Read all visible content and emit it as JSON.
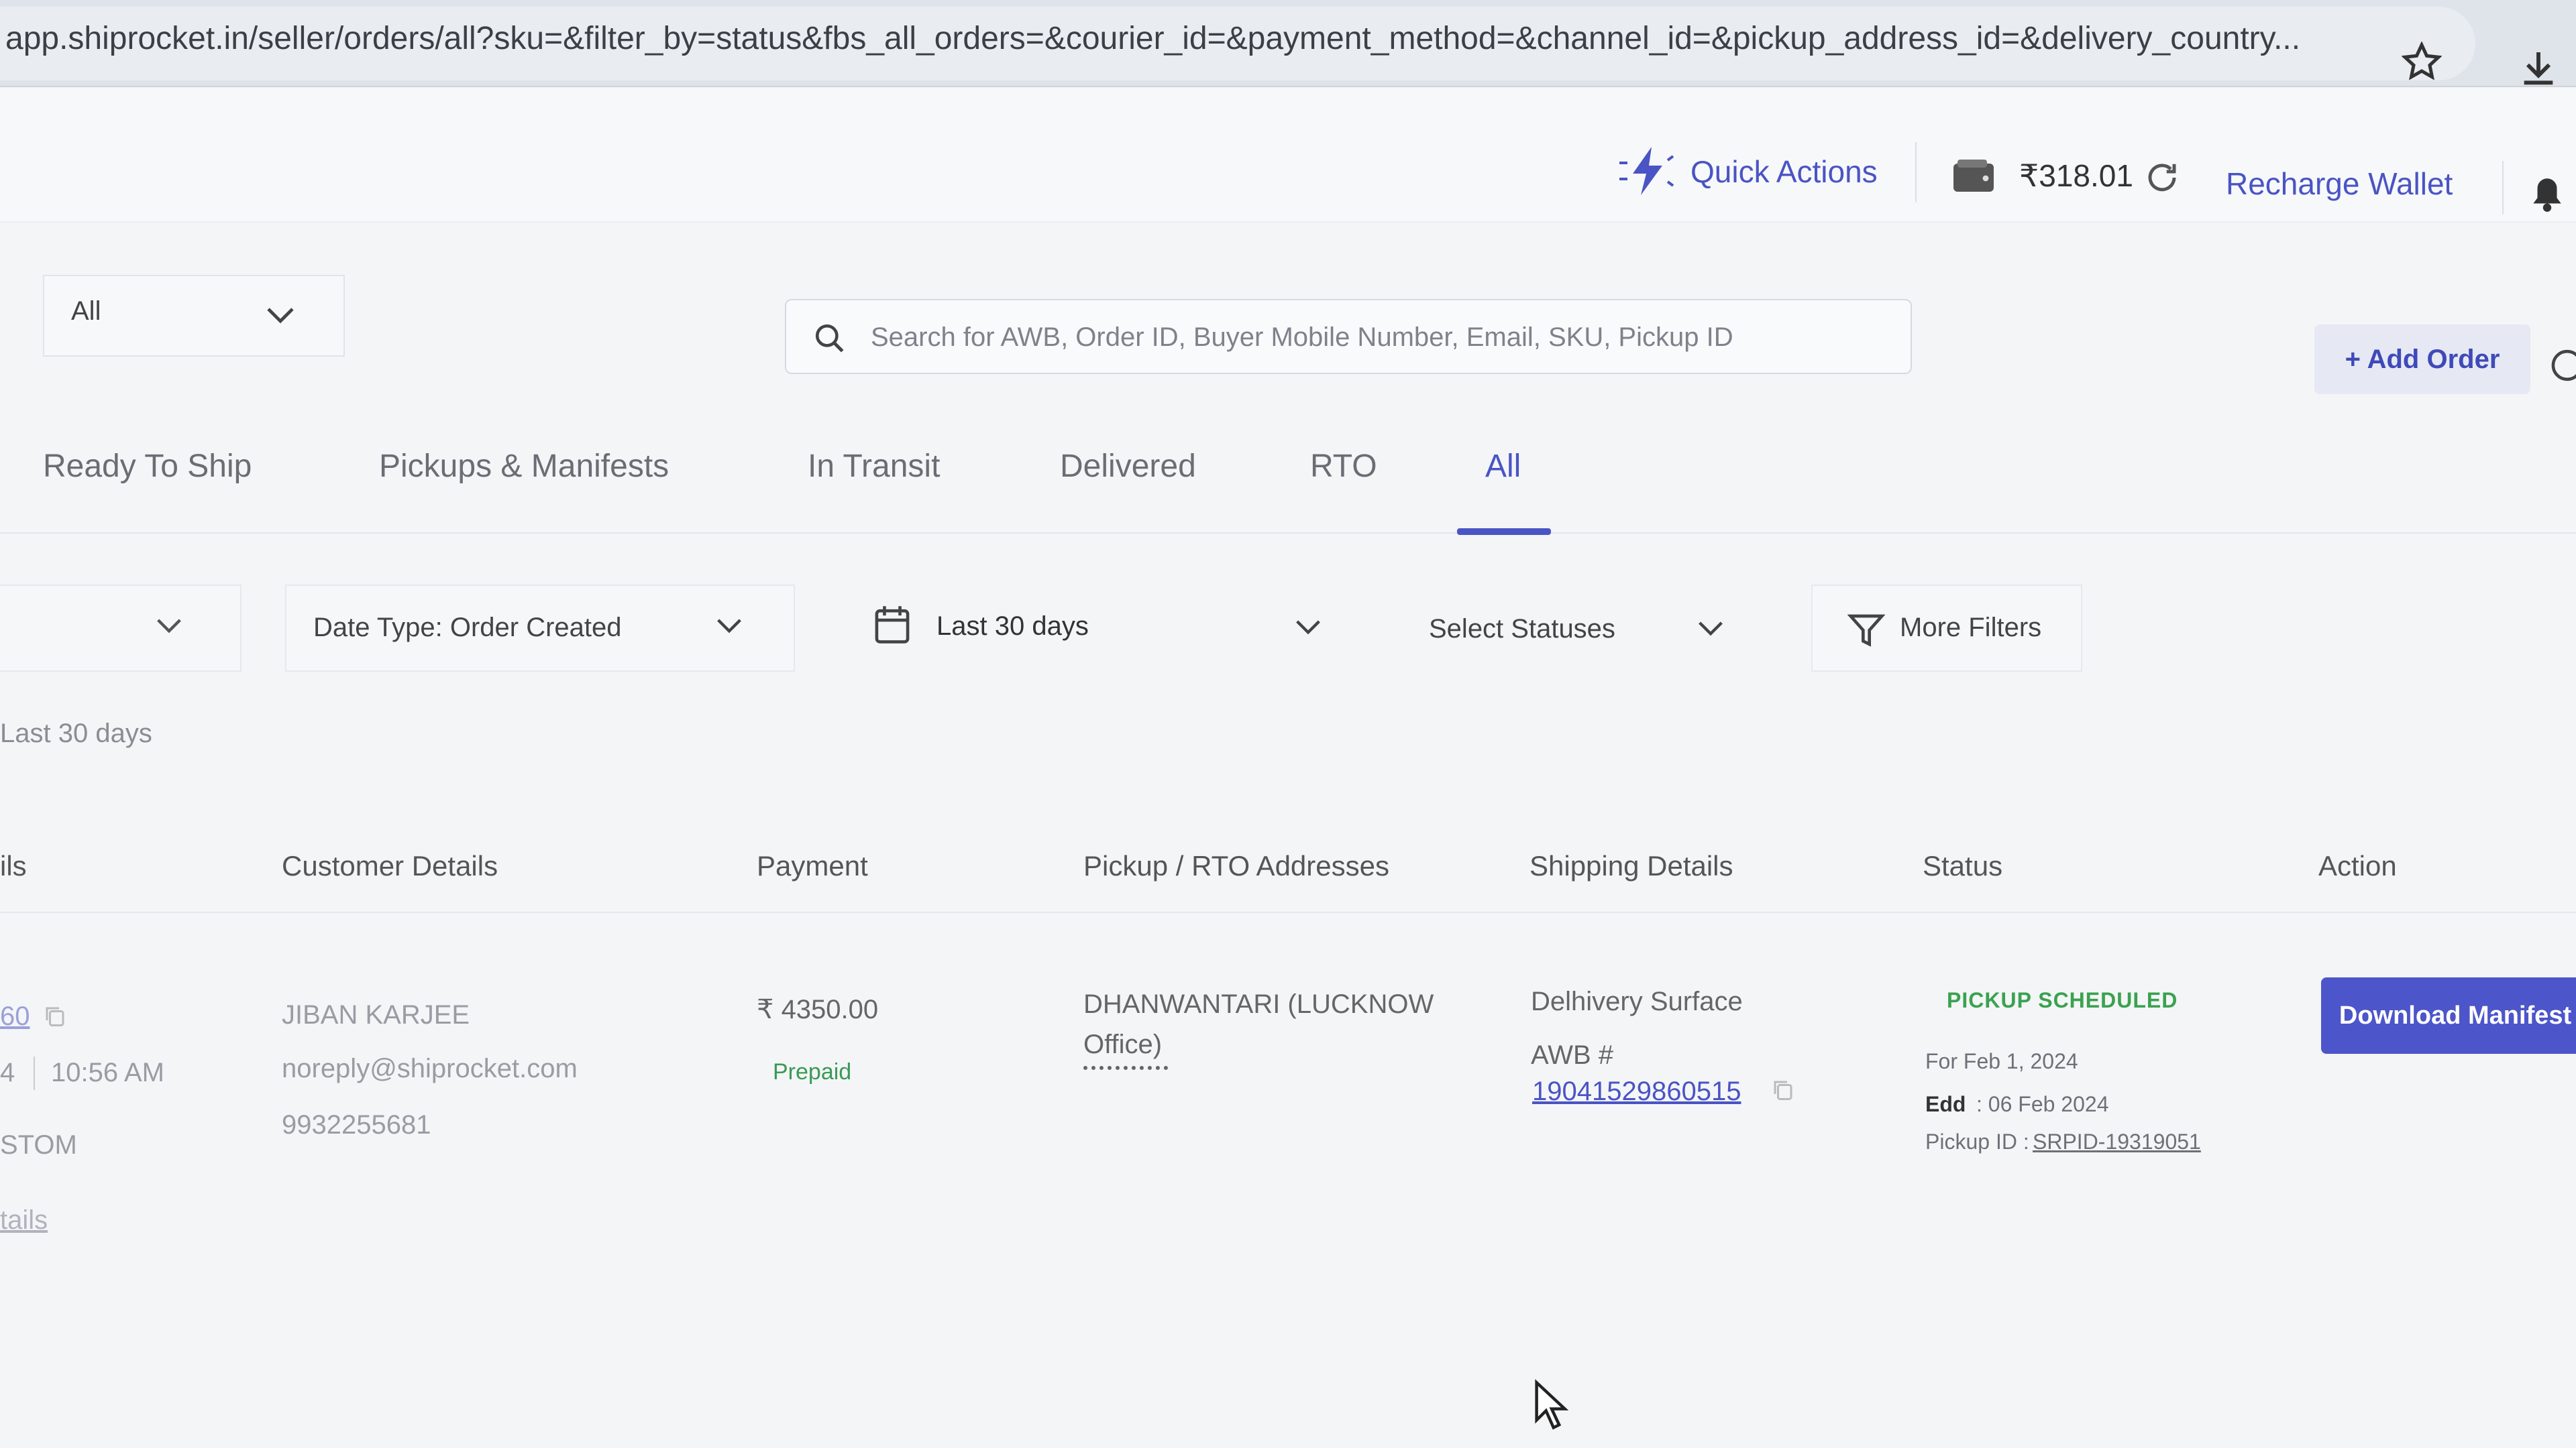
{
  "browser": {
    "url": "app.shiprocket.in/seller/orders/all?sku=&filter_by=status&fbs_all_orders=&courier_id=&payment_method=&channel_id=&pickup_address_id=&delivery_country..."
  },
  "header": {
    "quick_actions": "Quick Actions",
    "wallet_balance": "₹318.01",
    "recharge": "Recharge Wallet"
  },
  "search": {
    "channel_select": "All",
    "placeholder": "Search for AWB, Order ID, Buyer Mobile Number, Email, SKU, Pickup ID",
    "add_order": "+ Add Order"
  },
  "tabs": [
    {
      "label": "Ready To Ship"
    },
    {
      "label": "Pickups & Manifests"
    },
    {
      "label": "In Transit"
    },
    {
      "label": "Delivered"
    },
    {
      "label": "RTO"
    },
    {
      "label": "All",
      "active": true
    }
  ],
  "filters": {
    "date_type": "Date Type: Order Created",
    "date_range": "Last 30 days",
    "statuses": "Select Statuses",
    "more": "More Filters",
    "range_note": "Last 30 days"
  },
  "table": {
    "headers": [
      "ils",
      "Customer Details",
      "Payment",
      "Pickup / RTO Addresses",
      "Shipping Details",
      "Status",
      "Action"
    ],
    "row": {
      "order_id_partial": "60",
      "date_partial": "4",
      "time": "10:56 AM",
      "channel_partial": "STOM",
      "details_partial": "tails",
      "customer_name": "JIBAN KARJEE",
      "customer_email": "noreply@shiprocket.com",
      "customer_phone": "9932255681",
      "amount": "₹ 4350.00",
      "payment_method": "Prepaid",
      "pickup_line1": "DHANWANTARI (LUCKNOW",
      "pickup_line2": "Office)",
      "courier": "Delhivery Surface",
      "awb_label": "AWB #",
      "awb": "19041529860515",
      "status": "PICKUP SCHEDULED",
      "status_for": "For Feb 1, 2024",
      "edd_label": "Edd",
      "edd_value": ": 06 Feb 2024",
      "pickup_id_label": "Pickup ID :",
      "pickup_id": "SRPID-19319051",
      "action": "Download Manifest"
    }
  },
  "colors": {
    "accent": "#4a54c4",
    "status_green": "#3aa24f"
  }
}
